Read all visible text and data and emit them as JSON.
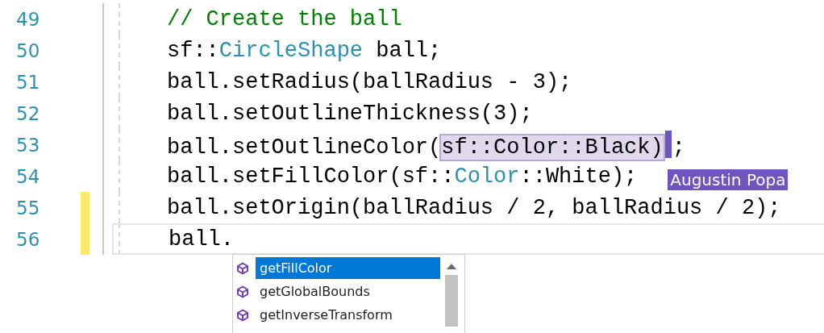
{
  "editor": {
    "lines": [
      {
        "number": "49",
        "changed": false,
        "current": false,
        "segments": [
          {
            "text": "// Create the ball",
            "kind": "comment"
          }
        ]
      },
      {
        "number": "50",
        "changed": false,
        "current": false,
        "segments": [
          {
            "text": "sf::",
            "kind": "plain"
          },
          {
            "text": "CircleShape",
            "kind": "type"
          },
          {
            "text": " ball;",
            "kind": "plain"
          }
        ]
      },
      {
        "number": "51",
        "changed": false,
        "current": false,
        "segments": [
          {
            "text": "ball.setRadius(ballRadius - 3);",
            "kind": "plain"
          }
        ]
      },
      {
        "number": "52",
        "changed": false,
        "current": false,
        "segments": [
          {
            "text": "ball.setOutlineThickness(3);",
            "kind": "plain"
          }
        ]
      },
      {
        "number": "53",
        "changed": false,
        "current": false,
        "segments": [
          {
            "text": "ball.setOutlineColor(",
            "kind": "plain"
          },
          {
            "text": "sf::Color::Black)",
            "kind": "highlighted",
            "caret": true
          },
          {
            "text": ";",
            "kind": "plain"
          }
        ]
      },
      {
        "number": "54",
        "changed": false,
        "current": false,
        "segments": [
          {
            "text": "ball.setFillColor(sf::",
            "kind": "plain"
          },
          {
            "text": "Color",
            "kind": "type"
          },
          {
            "text": "::White);",
            "kind": "plain"
          }
        ],
        "collaborator": "Augustin Popa"
      },
      {
        "number": "55",
        "changed": true,
        "current": false,
        "segments": [
          {
            "text": "ball.setOrigin(ballRadius / 2, ballRadius / 2);",
            "kind": "plain"
          }
        ]
      },
      {
        "number": "56",
        "changed": true,
        "current": true,
        "segments": [
          {
            "text": "ball.",
            "kind": "plain"
          }
        ]
      }
    ]
  },
  "completion": {
    "items": [
      {
        "label": "getFillColor",
        "selected": true
      },
      {
        "label": "getGlobalBounds",
        "selected": false
      },
      {
        "label": "getInverseTransform",
        "selected": false
      }
    ]
  }
}
